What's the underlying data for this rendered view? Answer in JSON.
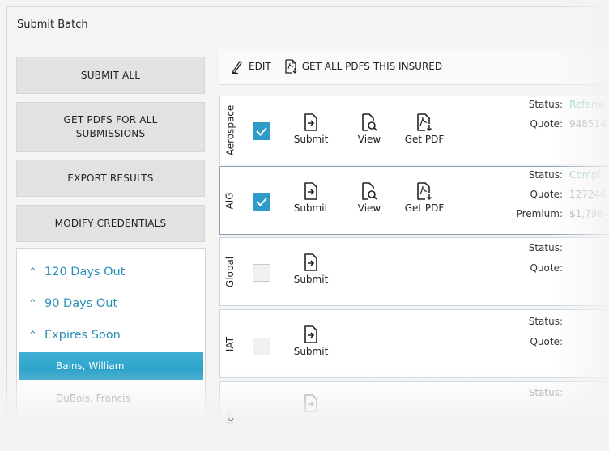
{
  "window": {
    "title": "Submit Batch"
  },
  "sidebar": {
    "buttons": [
      {
        "label": "SUBMIT ALL"
      },
      {
        "label": "GET PDFS FOR ALL\nSUBMISSIONS"
      },
      {
        "label": "EXPORT RESULTS"
      },
      {
        "label": "MODIFY CREDENTIALS"
      }
    ]
  },
  "tree": {
    "groups": [
      {
        "caret": "^",
        "label": "120 Days Out"
      },
      {
        "caret": "^",
        "label": "90 Days Out"
      },
      {
        "caret": "^",
        "label": "Expires Soon"
      }
    ],
    "items": [
      {
        "label": "Bains, William",
        "selected": true
      },
      {
        "label": "DuBois, Francis",
        "selected": false
      }
    ]
  },
  "toolbar": {
    "edit_label": "EDIT",
    "get_all_pdfs_label": "GET ALL PDFS THIS INSURED"
  },
  "actions": {
    "submit": "Submit",
    "view": "View",
    "get_pdf": "Get PDF"
  },
  "labels": {
    "status": "Status:",
    "quote": "Quote:",
    "premium": "Premium:"
  },
  "rows": [
    {
      "carrier": "Aerospace",
      "checked": true,
      "status": "Referre",
      "quote": "948514"
    },
    {
      "carrier": "AIG",
      "checked": true,
      "status": "Compl",
      "quote": "127246",
      "premium": "$1,796"
    },
    {
      "carrier": "Global",
      "checked": false
    },
    {
      "carrier": "IAT",
      "checked": false
    },
    {
      "carrier": "Ion"
    }
  ],
  "colors": {
    "accent": "#2f9bc8",
    "selected_row": "#2aa0c9",
    "status_value": "#8fd19e",
    "value_muted": "#a5a5a5",
    "tree_group": "#2a8fb5"
  }
}
